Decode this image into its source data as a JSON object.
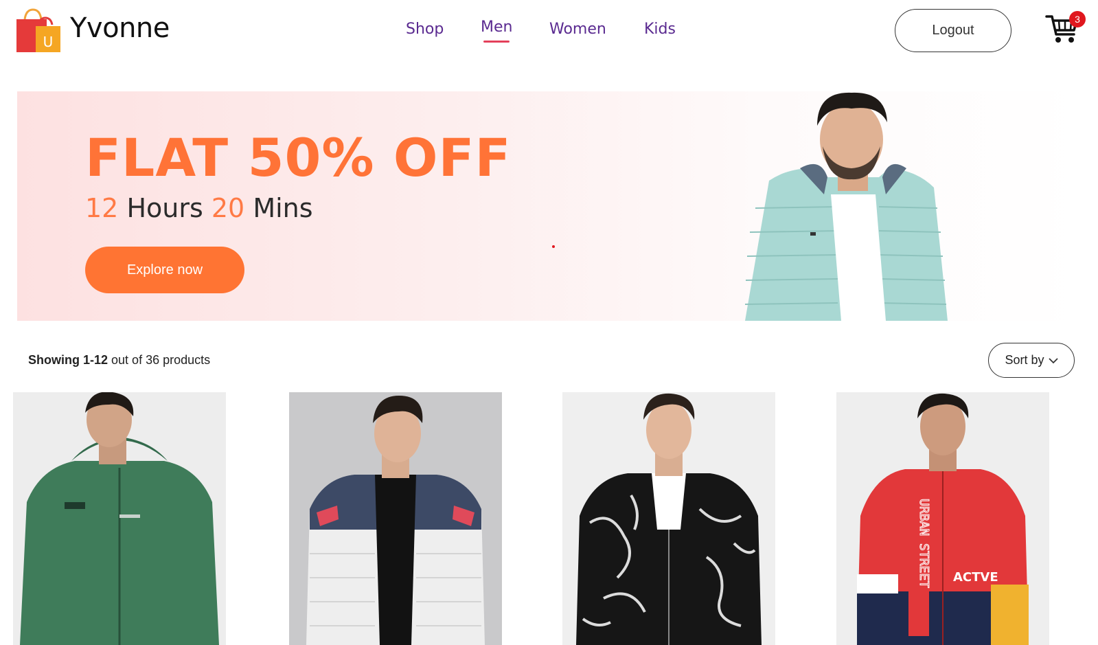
{
  "header": {
    "brand": "Yvonne",
    "logo_letter": "U",
    "nav": [
      {
        "label": "Shop",
        "active": false
      },
      {
        "label": "Men",
        "active": true
      },
      {
        "label": "Women",
        "active": false
      },
      {
        "label": "Kids",
        "active": false
      }
    ],
    "logout_label": "Logout",
    "cart_count": "3"
  },
  "banner": {
    "title": "FLAT 50% OFF",
    "hours_value": "12",
    "hours_label": "Hours",
    "mins_value": "20",
    "mins_label": "Mins",
    "cta_label": "Explore now"
  },
  "listing": {
    "showing_range": "Showing 1-12",
    "showing_rest": "out of 36 products",
    "sort_label": "Sort by"
  },
  "products": [
    {
      "name": "green-zip-hoodie",
      "bg": "#ededed"
    },
    {
      "name": "white-navy-puffer",
      "bg": "#c9c9cb"
    },
    {
      "name": "black-marble-bomber",
      "bg": "#efefef"
    },
    {
      "name": "red-navy-windbreaker",
      "bg": "#eeeeee"
    }
  ],
  "colors": {
    "accent_orange": "#ff7433",
    "nav_purple": "#5a2a90",
    "active_underline": "#e4405a",
    "badge_red": "#e0171e"
  }
}
